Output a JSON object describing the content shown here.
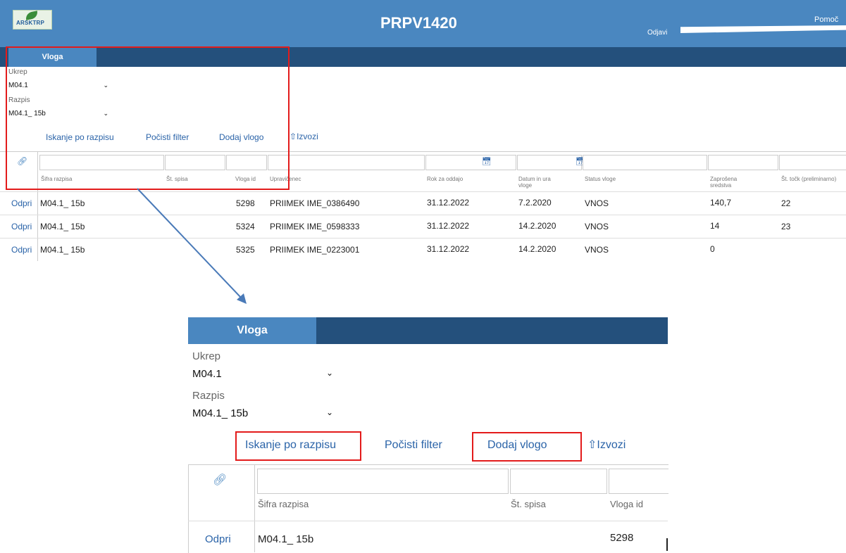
{
  "header": {
    "app_title": "PRPV1420",
    "logo_text": "ARSKTRP",
    "odjavi": "Odjavi",
    "pomoc": "Pomoč"
  },
  "tab": {
    "label": "Vloga"
  },
  "filters": {
    "ukrep_label": "Ukrep",
    "ukrep_value": "M04.1",
    "razpis_label": "Razpis",
    "razpis_value": "M04.1_ 15b"
  },
  "actions": {
    "iskanje": "Iskanje po razpisu",
    "pocisti": "Počisti filter",
    "dodaj": "Dodaj vlogo",
    "izvozi": "Izvozi"
  },
  "table": {
    "columns": {
      "sifra": "Šifra razpisa",
      "spis": "Št. spisa",
      "vloga_id": "Vloga id",
      "upravicenec": "Upravičenec",
      "rok": "Rok za oddajo",
      "datum": "Datum in ura vloge",
      "status": "Status vloge",
      "zaprosena": "Zaprošena sredstva",
      "tock": "Št. točk (preliminarno)"
    },
    "open_label": "Odpri",
    "rows": [
      {
        "sifra": "M04.1_ 15b",
        "vloga_id": "5298",
        "upravicenec": "PRIIMEK IME_0386490",
        "rok": "31.12.2022",
        "datum": "7.2.2020",
        "status": "VNOS",
        "zaprosena": "140,7",
        "tock": "22"
      },
      {
        "sifra": "M04.1_ 15b",
        "vloga_id": "5324",
        "upravicenec": "PRIIMEK IME_0598333",
        "rok": "31.12.2022",
        "datum": "14.2.2020",
        "status": "VNOS",
        "zaprosena": "14",
        "tock": "23"
      },
      {
        "sifra": "M04.1_ 15b",
        "vloga_id": "5325",
        "upravicenec": "PRIIMEK IME_0223001",
        "rok": "31.12.2022",
        "datum": "14.2.2020",
        "status": "VNOS",
        "zaprosena": "0",
        "tock": ""
      }
    ]
  },
  "colors": {
    "header_blue": "#4a87c0",
    "nav_dark_blue": "#24507c",
    "link_blue": "#2a63a8",
    "highlight_red": "#e31b1b"
  },
  "icons": [
    "link-icon",
    "calendar-icon",
    "export-icon",
    "chevron-down-icon"
  ]
}
